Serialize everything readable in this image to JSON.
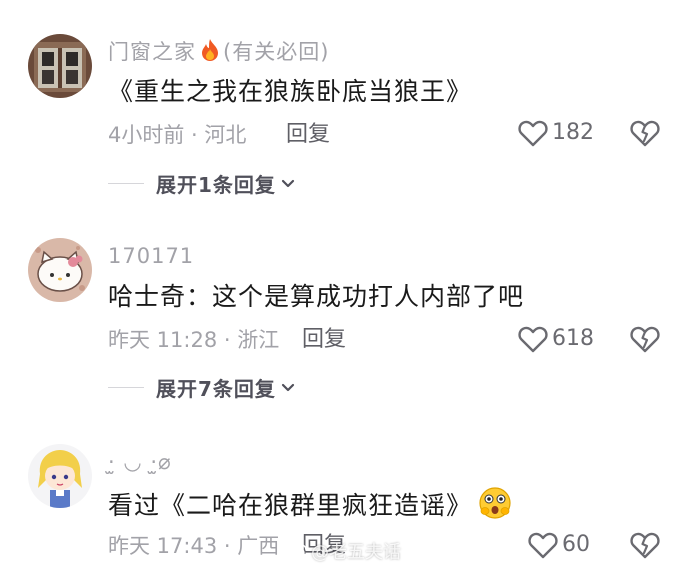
{
  "comments": [
    {
      "username": "门窗之家",
      "user_suffix": "(有关必回)",
      "text": "《重生之我在狼族卧底当狼王》",
      "meta": "4小时前 · 河北",
      "reply_label": "回复",
      "likes": "182",
      "expand_label": "展开1条回复"
    },
    {
      "username": "170171",
      "text": "哈士奇：这个是算成功打人内部了吧",
      "meta": "昨天 11:28 · 浙江",
      "reply_label": "回复",
      "likes": "618",
      "expand_label": "展开7条回复"
    },
    {
      "username": "·̫ ◡ ·̫⌀",
      "text": "看过《二哈在狼群里疯狂造谣》",
      "meta": "昨天 17:43 · 广西",
      "reply_label": "回复",
      "likes": "60"
    }
  ],
  "icons": {
    "fire": "fire-icon",
    "heart": "heart-outline-icon",
    "broken_heart": "broken-heart-icon",
    "chevron": "chevron-down-icon",
    "emoji": "shocked-emoji-icon"
  },
  "watermark": "@老五夫话",
  "colors": {
    "meta_gray": "#a2a2a8",
    "text": "#1a1a1a",
    "fire": "#f05a23"
  }
}
